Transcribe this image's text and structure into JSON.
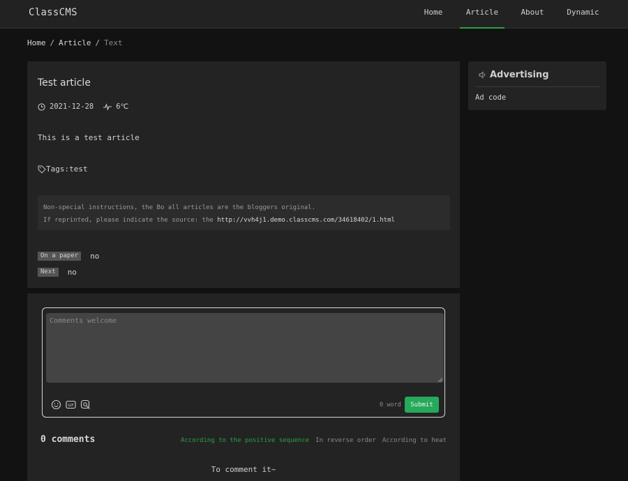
{
  "header": {
    "logo": "ClassCMS",
    "nav": [
      {
        "label": "Home",
        "active": false
      },
      {
        "label": "Article",
        "active": true
      },
      {
        "label": "About",
        "active": false
      },
      {
        "label": "Dynamic",
        "active": false
      }
    ]
  },
  "breadcrumb": {
    "items": [
      "Home",
      "Article",
      "Text"
    ]
  },
  "article": {
    "title": "Test article",
    "date": "2021-12-28",
    "heat": "6℃",
    "body": "This is a test article",
    "tags_prefix": "Tags: ",
    "tag": "test",
    "notice_line1": "Non-special instructions, the Bo all articles are the bloggers original.",
    "notice_line2_prefix": "If reprinted, please indicate the source: the ",
    "notice_link": "http://vvh4j1.demo.classcms.com/34618402/1.html",
    "prev_label": "On a paper",
    "prev_value": "no",
    "next_label": "Next",
    "next_value": "no"
  },
  "sidebar": {
    "title": "Advertising",
    "body": "Ad code"
  },
  "comments": {
    "placeholder": "Comments welcome",
    "word_count": "0 word",
    "submit_label": "Submit",
    "count_title": "0 comments",
    "sort": [
      {
        "label": "According to the positive sequence",
        "active": true
      },
      {
        "label": "In reverse order",
        "active": false
      },
      {
        "label": "According to heat",
        "active": false
      }
    ],
    "empty_text": "To comment it~"
  },
  "colors": {
    "accent_green": "#2ea043",
    "submit_green": "#25a95b",
    "background": "#121212",
    "card": "#232323"
  }
}
